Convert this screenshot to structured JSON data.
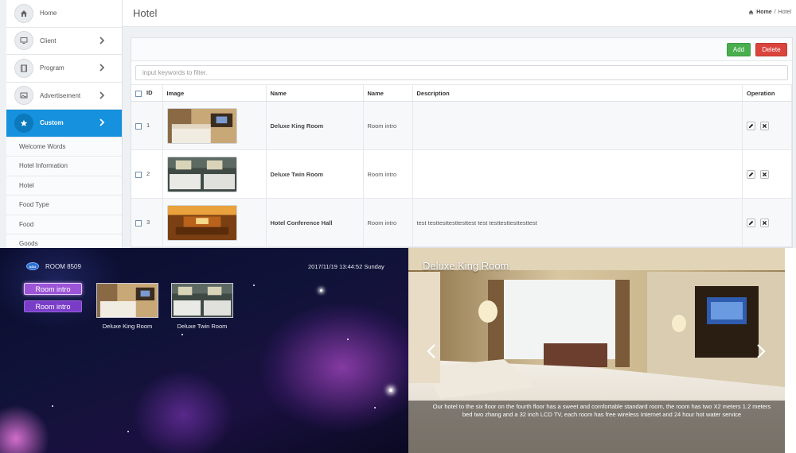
{
  "sidebar": {
    "items": [
      {
        "label": "Home",
        "icon": "home-icon",
        "has_arrow": false
      },
      {
        "label": "Client",
        "icon": "monitor-icon",
        "has_arrow": true
      },
      {
        "label": "Program",
        "icon": "film-icon",
        "has_arrow": true
      },
      {
        "label": "Advertisement",
        "icon": "image-icon",
        "has_arrow": true
      },
      {
        "label": "Custom",
        "icon": "star-icon",
        "has_arrow": true,
        "active": true
      }
    ],
    "subitems": [
      "Welcome Words",
      "Hotel Information",
      "Hotel",
      "Food Type",
      "Food",
      "Goods"
    ]
  },
  "header": {
    "title": "Hotel",
    "breadcrumb": {
      "home": "Home",
      "separator": "/",
      "current": "Hotel"
    }
  },
  "toolbar": {
    "add_label": "Add",
    "delete_label": "Delete"
  },
  "filter": {
    "placeholder": "input keywords to filter."
  },
  "table": {
    "columns": [
      "ID",
      "Image",
      "Name",
      "Name",
      "Description",
      "Operation"
    ],
    "rows": [
      {
        "id": "1",
        "name": "Deluxe King Room",
        "type": "Room intro",
        "description": ""
      },
      {
        "id": "2",
        "name": "Deluxe Twin Room",
        "type": "Room intro",
        "description": ""
      },
      {
        "id": "3",
        "name": "Hotel Conference Hall",
        "type": "Room intro",
        "description": "test testtesttesttesttest test testtesttesttesttest"
      }
    ]
  },
  "tv": {
    "logo": "ADU",
    "room": "ROOM 8509",
    "datetime": "2017/11/19  13:44:52  Sunday",
    "menu": [
      "Room intro",
      "Room intro"
    ],
    "cards": [
      "Deluxe King Room",
      "Deluxe Twin Room"
    ]
  },
  "detail": {
    "title": "Deluxe King Room",
    "description": "Our hotel to the six floor on the fourth floor has a sweet and comfortable standard room, the room has two X2 meters 1.2 meters bed two zhang and a 32 inch LCD TV, each room has free wireless Internet and 24 hour hot water service"
  },
  "colors": {
    "accent": "#1591dd",
    "add": "#49ae4d",
    "delete": "#d9443d",
    "tv_menu": "#9b55d6"
  }
}
